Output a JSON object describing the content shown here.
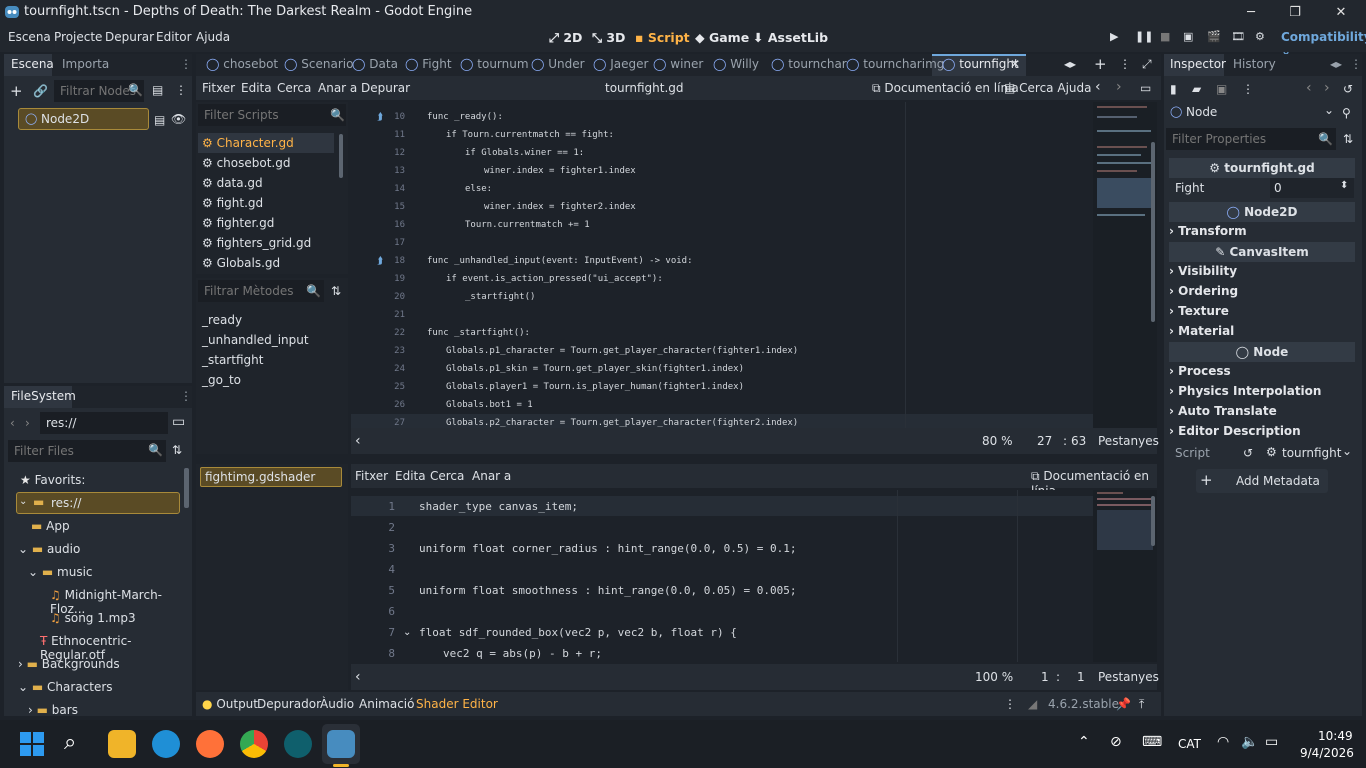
{
  "window": {
    "title": "tournfight.tscn - Depths of Death: The Darkest Realm - Godot Engine",
    "min": "─",
    "max": "❐",
    "close": "✕"
  },
  "menu": {
    "items": [
      "Escena",
      "Projecte",
      "Depurar",
      "Editor",
      "Ajuda"
    ],
    "workspaces": [
      "2D",
      "3D",
      "Script",
      "Game",
      "AssetLib"
    ],
    "renderer": "Compatibility"
  },
  "scene": {
    "tabs": [
      "Escena",
      "Importa"
    ],
    "filter_placeholder": "Filtrar Nodes",
    "root": "Node2D"
  },
  "filesystem": {
    "tab": "FileSystem",
    "path": "res://",
    "filter_placeholder": "Filter Files",
    "items": [
      "Favorits:",
      "res://",
      "App",
      "audio",
      "music",
      "Midnight-March-Floz...",
      "song 1.mp3",
      "Ethnocentric-Regular.otf",
      "Backgrounds",
      "Characters",
      "bars"
    ]
  },
  "script_tabs": [
    "chosebot",
    "Scenario",
    "Data",
    "Fight",
    "tournum",
    "Under",
    "Jaeger",
    "winer",
    "Willy",
    "tournchar",
    "tourncharimg",
    "tournfight"
  ],
  "script_menu": {
    "items": [
      "Fitxer",
      "Edita",
      "Cerca",
      "Anar a",
      "Depurar"
    ],
    "file": "tournfight.gd",
    "docs": "Documentació en línia",
    "help": "Cerca Ajuda"
  },
  "scripts": {
    "filter_placeholder": "Filter Scripts",
    "items": [
      "Character.gd",
      "chosebot.gd",
      "data.gd",
      "fight.gd",
      "fighter.gd",
      "fighters_grid.gd",
      "Globals.gd"
    ]
  },
  "methods": {
    "filter_placeholder": "Filtrar Mètodes",
    "items": [
      "_ready",
      "_unhandled_input",
      "_startfight",
      "_go_to"
    ]
  },
  "code": {
    "lines": [
      "10",
      "11",
      "12",
      "13",
      "14",
      "15",
      "16",
      "17",
      "18",
      "19",
      "20",
      "21",
      "22",
      "23",
      "24",
      "25",
      "26",
      "27"
    ],
    "text": [
      "func _ready():",
      "if Tourn.currentmatch == fight:",
      "if Globals.winer == 1:",
      "winer.index = fighter1.index",
      "else:",
      "winer.index = fighter2.index",
      "Tourn.currentmatch += 1",
      "",
      "func _unhandled_input(event: InputEvent) -> void:",
      "if event.is_action_pressed(\"ui_accept\"):",
      "_startfight()",
      "",
      "func _startfight():",
      "Globals.p1_character = Tourn.get_player_character(fighter1.index)",
      "Globals.p1_skin = Tourn.get_player_skin(fighter1.index)",
      "Globals.player1 = Tourn.is_player_human(fighter1.index)",
      "Globals.bot1 = 1",
      "Globals.p2_character = Tourn.get_player_character(fighter2.index)"
    ],
    "status": {
      "zoom": "80 %",
      "line": "27",
      "col": "63",
      "tabs": "Pestanyes"
    }
  },
  "shader": {
    "file": "fightimg.gdshader",
    "menu": [
      "Fitxer",
      "Edita",
      "Cerca",
      "Anar a"
    ],
    "docs": "Documentació en línia",
    "lines": [
      "1",
      "2",
      "3",
      "4",
      "5",
      "6",
      "7",
      "8"
    ],
    "text": [
      "shader_type canvas_item;",
      "",
      "uniform float corner_radius : hint_range(0.0, 0.5) = 0.1;",
      "",
      "uniform float smoothness : hint_range(0.0, 0.05) = 0.005;",
      "",
      "float sdf_rounded_box(vec2 p, vec2 b, float r) {",
      "vec2 q = abs(p) - b + r;"
    ],
    "status": {
      "zoom": "100 %",
      "line": "1",
      "col": "1",
      "tabs": "Pestanyes"
    }
  },
  "bottom": {
    "tabs": [
      "Output",
      "Depurador",
      "Àudio",
      "Animació",
      "Shader Editor"
    ],
    "version": "4.6.2.stable"
  },
  "inspector": {
    "tabs": [
      "Inspector",
      "History"
    ],
    "node": "Node",
    "filter_placeholder": "Filter Properties",
    "script_name": "tournfight.gd",
    "prop_name": "Fight",
    "prop_value": "0",
    "node2d": "Node2D",
    "canvas": "CanvasItem",
    "sections1": [
      "Transform"
    ],
    "sections2": [
      "Visibility",
      "Ordering",
      "Texture",
      "Material"
    ],
    "sections3": [
      "Process",
      "Physics Interpolation",
      "Auto Translate",
      "Editor Description"
    ],
    "script_label": "Script",
    "script_value": "tournfight",
    "add_meta": "Add Metadata"
  },
  "taskbar": {
    "lang": "CAT",
    "time": "10:49",
    "date": "9/4/2026"
  }
}
